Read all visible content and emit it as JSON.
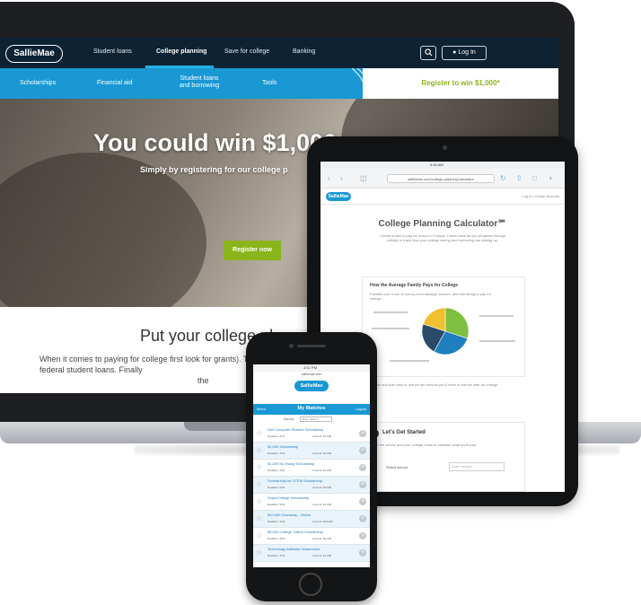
{
  "laptop": {
    "logo": "SallieMae",
    "nav": [
      "Student loans",
      "College planning",
      "Save for college",
      "Banking"
    ],
    "search_icon": "search-icon",
    "login": "Log In",
    "subnav": [
      "Scholarships",
      "Financial aid",
      "Student loans and borrowing",
      "Tools"
    ],
    "promo": "Register to win $1,000*",
    "hero_title": "You could win $1,000",
    "hero_subtitle": "Simply by registering for our college p",
    "hero_button": "Register now",
    "heading": "Put your college pl",
    "body": "When it comes to paying for college first look for grants). Then explore federal student loans. Finally",
    "body_tail": "the"
  },
  "tablet": {
    "status_time": "9:34 AM",
    "url": "salliemae.com/college-planning/calculator",
    "logo": "SallieMae",
    "login_link": "Log In | Create Account",
    "title": "College Planning Calculator℠",
    "description": "Create a plan to pay for school in 3 steps. Check back as you progress through college to track how your college saving and borrowing are adding up.",
    "card_title": "How the Average Family Pays for College",
    "card_text": "Families use a mix of money from savings, income, and borrowing to pay for college.",
    "pie": {
      "values": [
        30,
        28,
        22,
        20
      ],
      "colors": [
        "#7fbf3f",
        "#1f7fbf",
        "#2a4a6a",
        "#f0c030"
      ]
    },
    "note": "Research and plan now to reduce the amount you'll need to borrow later for college.",
    "gs_title": "Let's Get Started",
    "gs_text": "Enter the school and your college costs to estimate what you'll pay.",
    "gs_label": "Select school",
    "gs_placeholder": "Enter school"
  },
  "phone": {
    "status_time": "4:52 PM",
    "url": "salliemae.com",
    "logo": "SallieMae",
    "tab_left": "Menu",
    "tab_center": "My Matches",
    "tab_right": "Logout",
    "sort_label": "Sort by",
    "sort_value": "Best match",
    "items": [
      {
        "name": "Dell Computer Student Scholarship",
        "deadline": "Deadline: 5/31",
        "amount": "Amount: $1,000"
      },
      {
        "name": "$1,000 Scholarship",
        "deadline": "Deadline: 7/31",
        "amount": "Amount: $1,000"
      },
      {
        "name": "$1,000 No Essay Scholarship",
        "deadline": "Deadline: 5/31",
        "amount": "Amount: $1,000"
      },
      {
        "name": "Scholarship for STEM Scholarship",
        "deadline": "Deadline: 6/01",
        "amount": "Amount: $2,500"
      },
      {
        "name": "SuperCollege Scholarship",
        "deadline": "Deadline: 5/31",
        "amount": "Amount: $1,000"
      },
      {
        "name": "$10,000 Giveaway - Online",
        "deadline": "Deadline: 6/30",
        "amount": "Amount: $10,000"
      },
      {
        "name": "$5,000 College Tuition Scholarship",
        "deadline": "Deadline: 6/15",
        "amount": "Amount: $5,000"
      },
      {
        "name": "Technology Addiction Awareness",
        "deadline": "Deadline: 7/31",
        "amount": "Amount: $1,000"
      }
    ]
  }
}
